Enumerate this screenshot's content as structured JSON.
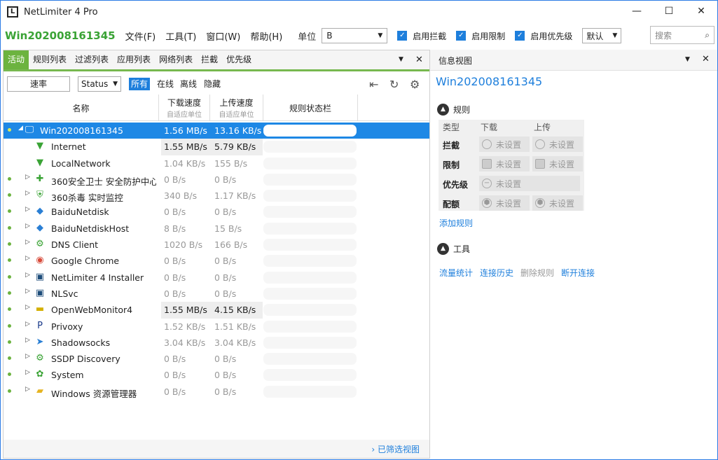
{
  "window": {
    "title": "NetLimiter 4 Pro",
    "logo": "L",
    "minimize": "—",
    "maximize": "☐",
    "close": "✕"
  },
  "menubar": {
    "machine": "Win202008161345",
    "menus": [
      "文件(F)",
      "工具(T)",
      "窗口(W)",
      "帮助(H)"
    ],
    "unit_label": "单位",
    "unit_value": "B",
    "checks": [
      "启用拦截",
      "启用限制",
      "启用优先级"
    ],
    "priority_value": "默认",
    "search_placeholder": "搜索"
  },
  "left": {
    "tabs": [
      "活动",
      "规则列表",
      "过滤列表",
      "应用列表",
      "网络列表",
      "拦截",
      "优先级"
    ],
    "rate_label": "速率",
    "status_label": "Status",
    "filters": [
      "所有",
      "在线",
      "离线",
      "隐藏"
    ],
    "columns": {
      "name": "名称",
      "download": "下载速度",
      "download_sub": "自适应单位",
      "upload": "上传速度",
      "upload_sub": "自适应单位",
      "bar": "规则状态栏"
    },
    "rows": [
      {
        "name": "Win202008161345",
        "dl": "1.56 MB/s",
        "ul": "13.16 KB/s",
        "icon": "monitor-icon",
        "glyph": "🖵"
      },
      {
        "name": "Internet",
        "dl": "1.55 MB/s",
        "ul": "5.79 KB/s",
        "icon": "filter-icon",
        "glyph": "▼"
      },
      {
        "name": "LocalNetwork",
        "dl": "1.04 KB/s",
        "ul": "155 B/s",
        "icon": "filter-icon",
        "glyph": "▼"
      },
      {
        "name": "360安全卫士 安全防护中心模块",
        "dl": "0 B/s",
        "ul": "0 B/s",
        "icon": "360-safe-icon",
        "glyph": "✚"
      },
      {
        "name": "360杀毒 实时监控",
        "dl": "340 B/s",
        "ul": "1.17 KB/s",
        "icon": "360-antivirus-icon",
        "glyph": "⛨"
      },
      {
        "name": "BaiduNetdisk",
        "dl": "0 B/s",
        "ul": "0 B/s",
        "icon": "baidu-netdisk-icon",
        "glyph": "◆"
      },
      {
        "name": "BaiduNetdiskHost",
        "dl": "8 B/s",
        "ul": "15 B/s",
        "icon": "baidu-netdisk-icon",
        "glyph": "◆"
      },
      {
        "name": "DNS Client",
        "dl": "1020 B/s",
        "ul": "166 B/s",
        "icon": "gear-icon",
        "glyph": "⚙"
      },
      {
        "name": "Google Chrome",
        "dl": "0 B/s",
        "ul": "0 B/s",
        "icon": "chrome-icon",
        "glyph": "◉"
      },
      {
        "name": "NetLimiter 4 Installer",
        "dl": "0 B/s",
        "ul": "0 B/s",
        "icon": "netlimiter-icon",
        "glyph": "▣"
      },
      {
        "name": "NLSvc",
        "dl": "0 B/s",
        "ul": "0 B/s",
        "icon": "netlimiter-icon",
        "glyph": "▣"
      },
      {
        "name": "OpenWebMonitor4",
        "dl": "1.55 MB/s",
        "ul": "4.15 KB/s",
        "icon": "webmonitor-icon",
        "glyph": "▬"
      },
      {
        "name": "Privoxy",
        "dl": "1.52 KB/s",
        "ul": "1.51 KB/s",
        "icon": "privoxy-icon",
        "glyph": "P"
      },
      {
        "name": "Shadowsocks",
        "dl": "3.04 KB/s",
        "ul": "3.04 KB/s",
        "icon": "paper-plane-icon",
        "glyph": "➤"
      },
      {
        "name": "SSDP Discovery",
        "dl": "0 B/s",
        "ul": "0 B/s",
        "icon": "gear-icon",
        "glyph": "⚙"
      },
      {
        "name": "System",
        "dl": "0 B/s",
        "ul": "0 B/s",
        "icon": "system-icon",
        "glyph": "✿"
      },
      {
        "name": "Windows 资源管理器",
        "dl": "0 B/s",
        "ul": "0 B/s",
        "icon": "folder-icon",
        "glyph": "▰"
      }
    ],
    "filtered_view": "› 已筛选视图"
  },
  "right": {
    "title": "信息视图",
    "machine": "Win202008161345",
    "rules_title": "规则",
    "grid": {
      "type": "类型",
      "download": "下载",
      "upload": "上传",
      "block": "拦截",
      "limit": "限制",
      "priority": "优先级",
      "quota": "配额",
      "unset": "未设置"
    },
    "add_rule": "添加规则",
    "tools_title": "工具",
    "tools": [
      "流量统计",
      "连接历史",
      "删除规则",
      "断开连接"
    ]
  }
}
